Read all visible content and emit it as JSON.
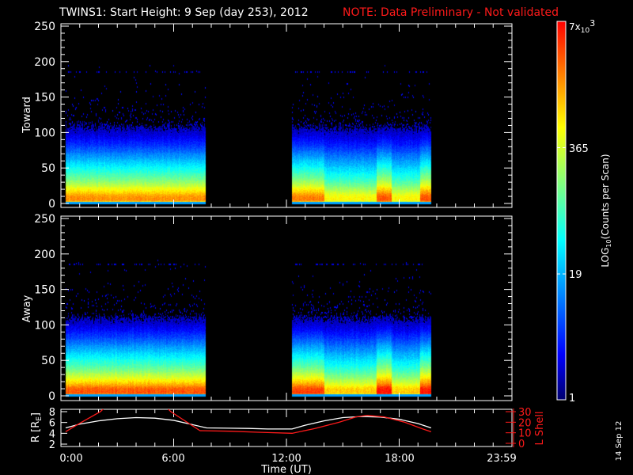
{
  "title": {
    "main": "TWINS1: Start Height:  9 Sep (day 253), 2012",
    "note": "NOTE: Data Preliminary - Not validated"
  },
  "colors": {
    "note": "#ff1a1a",
    "axes": "#ffffff",
    "l_shell": "#ff1a1a",
    "r_line": "#ffffff"
  },
  "chart_data": {
    "type": "heatmap",
    "x_axis": {
      "label": "Time (UT)",
      "range_hours": [
        0,
        24
      ],
      "major_tick_hours": [
        0,
        6,
        12,
        18,
        24
      ],
      "tick_labels": [
        "0:00",
        "6:00",
        "12:00",
        "18:00",
        "23:59"
      ]
    },
    "data_intervals_hours": [
      [
        0.25,
        7.72
      ],
      [
        12.3,
        19.7
      ]
    ],
    "panels": [
      {
        "name": "Toward",
        "ylim": [
          0,
          250
        ],
        "yticks": [
          "0",
          "50",
          "100",
          "150",
          "200",
          "250"
        ],
        "profile_height": [
          0,
          2,
          3,
          6,
          10,
          15,
          20,
          30,
          40,
          50,
          60,
          70,
          80,
          90,
          100,
          110,
          120
        ],
        "profile_log_counts": [
          1.2,
          1.2,
          3.0,
          3.25,
          3.2,
          3.0,
          2.75,
          2.3,
          1.95,
          1.65,
          1.35,
          1.05,
          0.75,
          0.5,
          0.28,
          0.1,
          0
        ]
      },
      {
        "name": "Away",
        "ylim": [
          0,
          250
        ],
        "yticks": [
          "0",
          "50",
          "100",
          "150",
          "200",
          "250"
        ],
        "profile_height": [
          0,
          2,
          3,
          6,
          10,
          15,
          20,
          30,
          40,
          50,
          60,
          70,
          80,
          90,
          100,
          110,
          120
        ],
        "profile_log_counts": [
          1.2,
          1.2,
          3.35,
          3.5,
          3.45,
          3.2,
          2.9,
          2.45,
          2.05,
          1.75,
          1.45,
          1.15,
          0.85,
          0.58,
          0.34,
          0.14,
          0
        ]
      }
    ],
    "intensity_segments_hours": [
      [
        0.25,
        7.72,
        1.0
      ],
      [
        12.3,
        14.0,
        1.03
      ],
      [
        14.0,
        16.8,
        0.86
      ],
      [
        16.8,
        17.6,
        1.08
      ],
      [
        17.6,
        19.1,
        0.86
      ],
      [
        19.1,
        19.7,
        1.08
      ]
    ],
    "colorbar": {
      "label_prefix": "LOG",
      "label_sub": "10",
      "label_suffix": "(Counts per Scan)",
      "range": [
        1,
        7000
      ],
      "ticks": [
        19,
        365
      ],
      "tick_labels": [
        "1",
        "19",
        "365"
      ],
      "max_label": "7x",
      "max_label_base": "10",
      "max_label_exp": "3"
    },
    "orbit": {
      "ylabel": "R [R",
      "ylabel_sub": "E",
      "ylabel_end": "]",
      "ylim": [
        2,
        8
      ],
      "yticks": [
        "2",
        "4",
        "6",
        "8"
      ],
      "y2label": "L Shell",
      "y2lim": [
        0,
        30
      ],
      "y2ticks": [
        "0",
        "10",
        "20",
        "30"
      ],
      "time_hours": [
        0.25,
        1,
        2,
        3,
        4,
        5,
        6,
        7,
        7.75,
        9,
        10,
        11,
        12.3,
        13,
        14,
        15,
        16,
        17,
        18,
        19,
        19.7
      ],
      "R": [
        5.0,
        5.7,
        6.3,
        6.7,
        6.9,
        6.8,
        6.4,
        5.6,
        5.0,
        4.95,
        4.9,
        4.8,
        4.8,
        5.5,
        6.3,
        6.9,
        7.1,
        7.0,
        6.6,
        5.8,
        5.0
      ],
      "L_time_hours": [
        0.25,
        1.0,
        2.1,
        3,
        4,
        5,
        5.85,
        7.4,
        9,
        10.5,
        12.3,
        13.5,
        14.8,
        15.7,
        16.3,
        17.2,
        18.3,
        19.2,
        19.7
      ],
      "L": [
        11,
        19,
        30,
        45,
        48,
        45,
        30,
        12,
        11.5,
        10.5,
        9.5,
        14,
        20,
        25,
        26.5,
        25,
        20,
        14,
        11
      ]
    }
  },
  "footer_date": "14 Sep 12"
}
